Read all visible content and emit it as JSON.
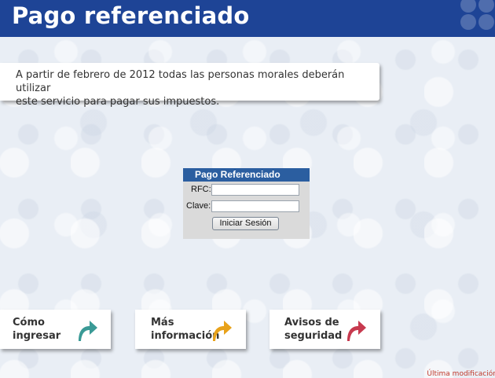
{
  "header": {
    "title": "Pago referenciado"
  },
  "notice": {
    "line1": "A partir de febrero de 2012 todas las personas morales deberán utilizar",
    "line2": "este servicio para pagar sus impuestos."
  },
  "login": {
    "title": "Pago Referenciado",
    "rfc_label": "RFC:",
    "clave_label": "Clave:",
    "rfc_value": "",
    "clave_value": "",
    "button_label": "Iniciar Sesión"
  },
  "cards": [
    {
      "line1": "Cómo",
      "line2": "ingresar",
      "icon": "arrow-teal-icon",
      "color": "#3a9a96"
    },
    {
      "line1": "Más",
      "line2": "información",
      "icon": "arrow-orange-icon",
      "color": "#e8a21a"
    },
    {
      "line1": "Avisos de",
      "line2": "seguridad",
      "icon": "arrow-red-icon",
      "color": "#c73a4f"
    }
  ],
  "footer": {
    "text": "Última modificación:"
  },
  "colors": {
    "header_bg": "#1e4496",
    "login_title_bg": "#2b5ea0"
  }
}
